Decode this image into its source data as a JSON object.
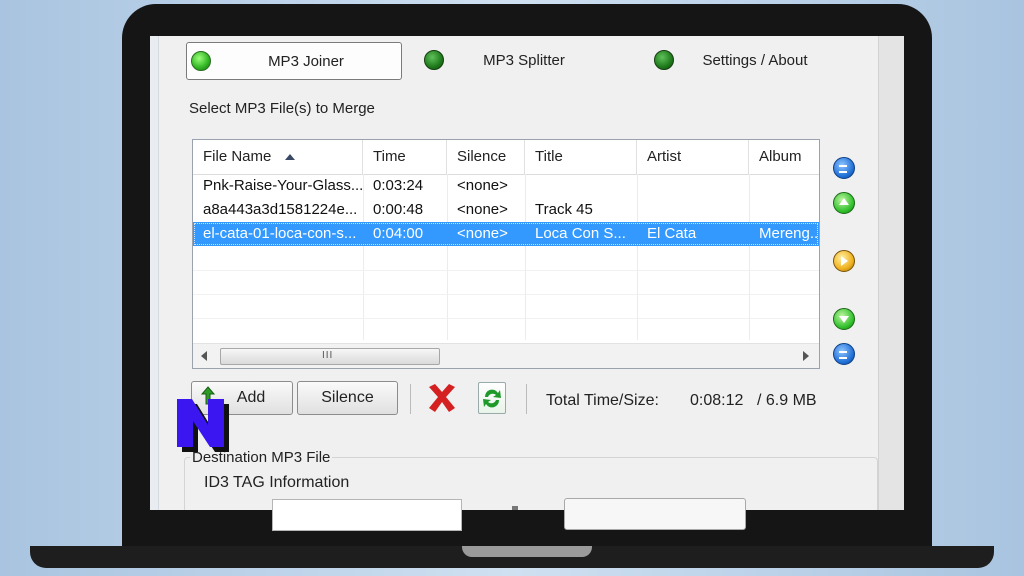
{
  "tabs": [
    {
      "label": "MP3 Joiner",
      "active": true
    },
    {
      "label": "MP3 Splitter",
      "active": false
    },
    {
      "label": "Settings / About",
      "active": false
    }
  ],
  "section_label": "Select MP3 File(s) to Merge",
  "file_list": {
    "columns": [
      "File Name",
      "Time",
      "Silence",
      "Title",
      "Artist",
      "Album"
    ],
    "sort_column": "File Name",
    "rows": [
      {
        "file_name": "Pnk-Raise-Your-Glass...",
        "time": "0:03:24",
        "silence": "<none>",
        "title": "",
        "artist": "",
        "album": "",
        "selected": false
      },
      {
        "file_name": "a8a443a3d1581224e...",
        "time": "0:00:48",
        "silence": "<none>",
        "title": "Track 45",
        "artist": "",
        "album": "",
        "selected": false
      },
      {
        "file_name": "el-cata-01-loca-con-s...",
        "time": "0:04:00",
        "silence": "<none>",
        "title": "Loca Con S...",
        "artist": "El Cata",
        "album": "Mereng...",
        "selected": true
      }
    ],
    "scroll_grip": "III"
  },
  "toolbar": {
    "add_label": "Add",
    "silence_label": "Silence",
    "total_label": "Total Time/Size:",
    "total_time": "0:08:12",
    "total_size": "/  6.9 MB"
  },
  "destination": {
    "group_label": "Destination MP3 File",
    "id3_label": "ID3 TAG Information"
  },
  "overlay_logo_letter": "N",
  "colors": {
    "selection": "#3399ff",
    "led_active": "#2fb422",
    "delete_red": "#d42020",
    "logo_purple": "#3b16f0"
  }
}
